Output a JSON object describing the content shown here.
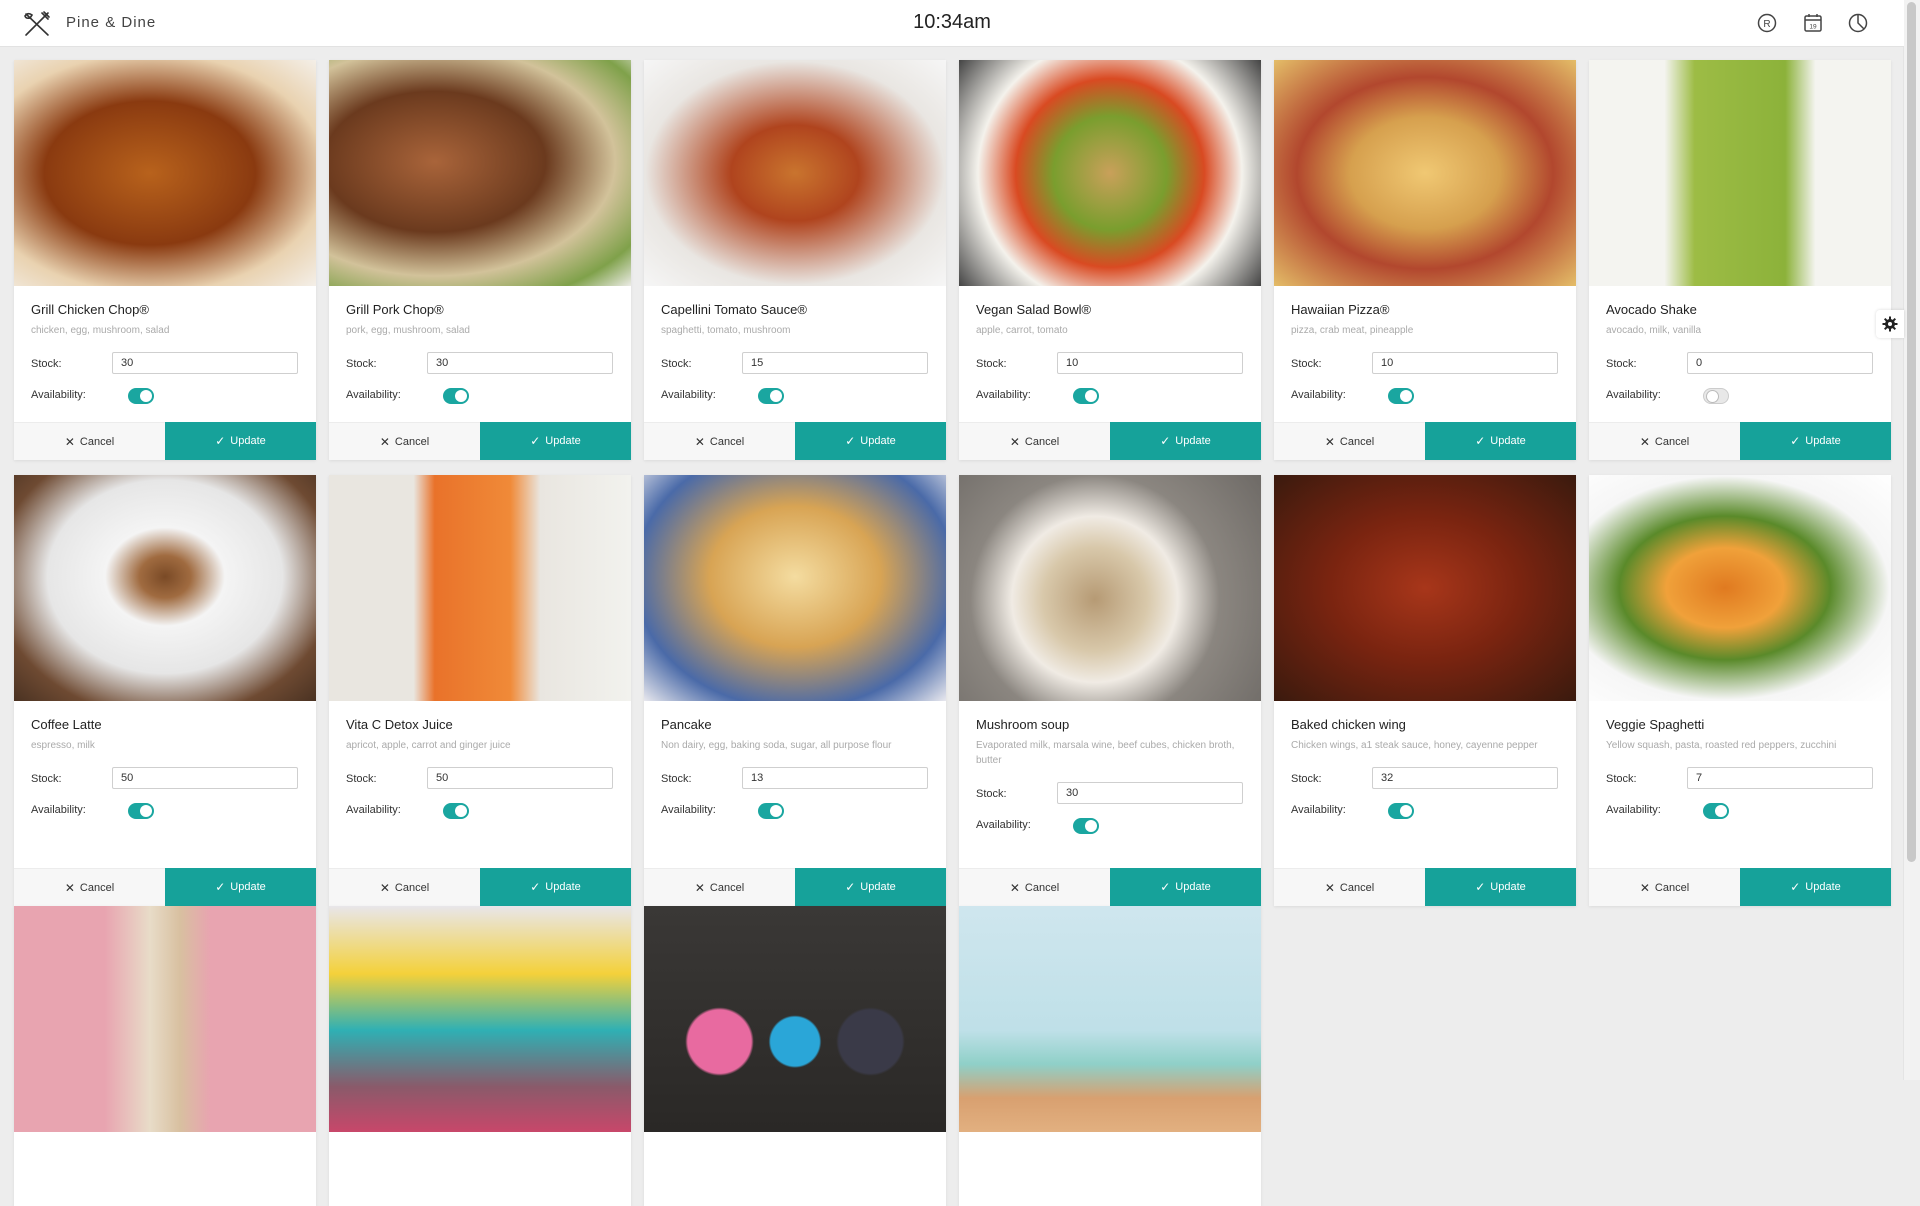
{
  "header": {
    "brand": "Pine & Dine",
    "time": "10:34am",
    "icons": [
      "registered-icon",
      "calendar-icon",
      "pie-chart-icon"
    ],
    "calendar_day": "19"
  },
  "labels": {
    "stock": "Stock:",
    "availability": "Availability:",
    "cancel": "Cancel",
    "update": "Update"
  },
  "colors": {
    "accent": "#16a29a",
    "toggle_on": "#1aa6a0"
  },
  "items": [
    {
      "name": "Grill Chicken Chop®",
      "desc": "chicken, egg, mushroom, salad",
      "stock": "30",
      "available": true,
      "image": "grilled-chicken"
    },
    {
      "name": "Grill Pork Chop®",
      "desc": "pork, egg, mushroom, salad",
      "stock": "30",
      "available": true,
      "image": "grilled-pork"
    },
    {
      "name": "Capellini Tomato Sauce®",
      "desc": "spaghetti, tomato, mushroom",
      "stock": "15",
      "available": true,
      "image": "pasta-tomato"
    },
    {
      "name": "Vegan Salad Bowl®",
      "desc": "apple, carrot, tomato",
      "stock": "10",
      "available": true,
      "image": "salad-bowl"
    },
    {
      "name": "Hawaiian Pizza®",
      "desc": "pizza, crab meat, pineapple",
      "stock": "10",
      "available": true,
      "image": "pizza"
    },
    {
      "name": "Avocado Shake",
      "desc": "avocado, milk, vanilla",
      "stock": "0",
      "available": false,
      "image": "avocado-shake"
    },
    {
      "name": "Coffee Latte",
      "desc": "espresso, milk",
      "stock": "50",
      "available": true,
      "image": "coffee-latte"
    },
    {
      "name": "Vita C Detox Juice",
      "desc": "apricot, apple, carrot and ginger juice",
      "stock": "50",
      "available": true,
      "image": "orange-juice"
    },
    {
      "name": "Pancake",
      "desc": "Non dairy, egg, baking soda, sugar, all purpose flour",
      "stock": "13",
      "available": true,
      "image": "pancakes"
    },
    {
      "name": "Mushroom soup",
      "desc": "Evaporated milk, marsala wine, beef cubes, chicken broth, butter",
      "stock": "30",
      "available": true,
      "image": "mushroom-soup"
    },
    {
      "name": "Baked chicken wing",
      "desc": "Chicken wings, a1 steak sauce, honey, cayenne pepper",
      "stock": "32",
      "available": true,
      "image": "chicken-wings"
    },
    {
      "name": "Veggie Spaghetti",
      "desc": "Yellow squash, pasta, roasted red peppers, zucchini",
      "stock": "7",
      "available": true,
      "image": "veggie-spaghetti"
    },
    {
      "image": "ice-cream"
    },
    {
      "image": "macarons"
    },
    {
      "image": "donuts"
    },
    {
      "image": "cupcakes"
    }
  ]
}
